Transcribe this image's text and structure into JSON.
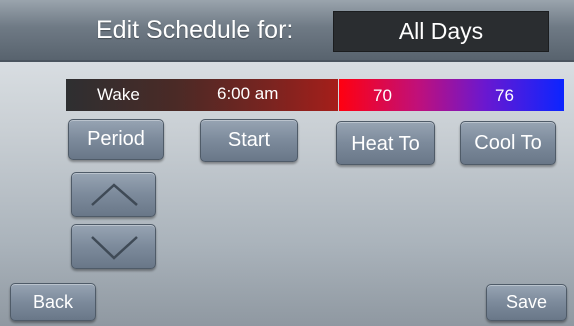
{
  "header": {
    "title": "Edit Schedule for:",
    "day_selection": "All Days"
  },
  "schedule_row": {
    "period": "Wake",
    "start_time": "6:00 am",
    "heat_setpoint": "70",
    "cool_setpoint": "76"
  },
  "buttons": {
    "period": "Period",
    "start": "Start",
    "heat_to": "Heat To",
    "cool_to": "Cool To",
    "back": "Back",
    "save": "Save"
  },
  "icons": {
    "up": "chevron-up-icon",
    "down": "chevron-down-icon"
  },
  "colors": {
    "heat": "#ff0010",
    "cool": "#0b25ff",
    "header": "#6f7a85"
  }
}
